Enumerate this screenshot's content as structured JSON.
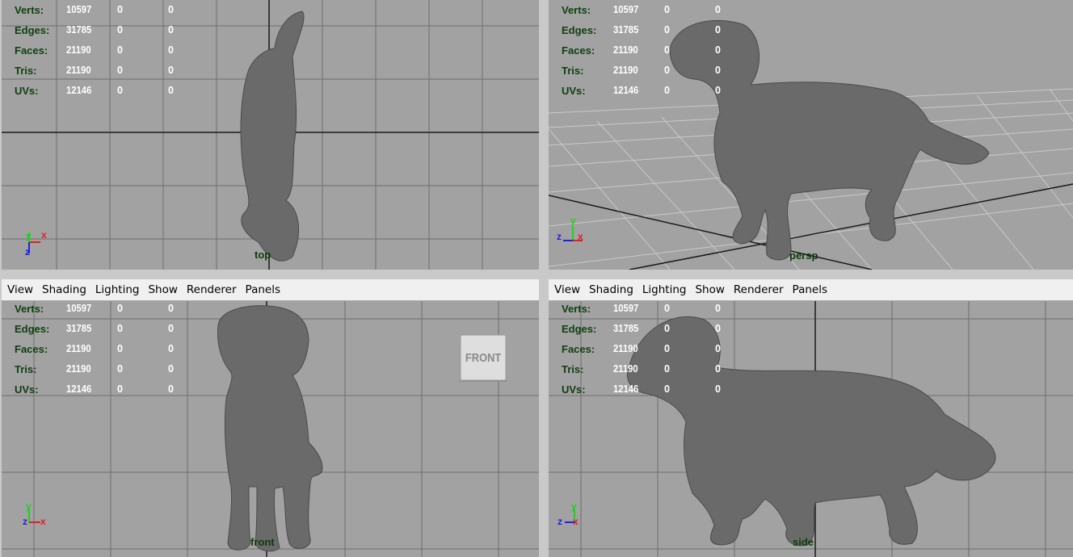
{
  "menu": [
    "View",
    "Shading",
    "Lighting",
    "Show",
    "Renderer",
    "Panels"
  ],
  "hud": {
    "rows": [
      {
        "label": "Verts:",
        "values": [
          "10597",
          "0",
          "0"
        ]
      },
      {
        "label": "Edges:",
        "values": [
          "31785",
          "0",
          "0"
        ]
      },
      {
        "label": "Faces:",
        "values": [
          "21190",
          "0",
          "0"
        ]
      },
      {
        "label": "Tris:",
        "values": [
          "21190",
          "0",
          "0"
        ]
      },
      {
        "label": "UVs:",
        "values": [
          "12146",
          "0",
          "0"
        ]
      }
    ]
  },
  "cameras": {
    "top": "top",
    "persp": "persp",
    "front": "front",
    "side": "side"
  },
  "viewcube_label": "FRONT",
  "axes": {
    "x": "x",
    "y": "y",
    "z": "z"
  },
  "colors": {
    "viewport_bg": "#a2a2a2",
    "grid": "#6e6e6e",
    "grid_axis": "#1a1a1a",
    "hud_label": "#0f3f10",
    "hud_value": "#ffffff",
    "axis_x": "#e02020",
    "axis_y": "#20d020",
    "axis_z": "#2020e0"
  }
}
